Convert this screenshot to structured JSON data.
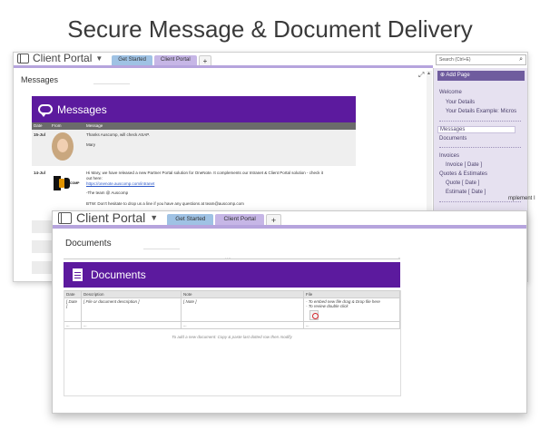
{
  "headline": "Secure Message & Document Delivery",
  "colors": {
    "accent_purple": "#5c1a9e",
    "tab_blue": "#9fc2e4",
    "tab_lilac": "#c6b6e6",
    "sidebar_bg": "#e6e1f0"
  },
  "back_window": {
    "notebook_title": "Client Portal",
    "tabs": [
      "Get Started",
      "Client Portal",
      "+"
    ],
    "search_placeholder": "Search (Ctrl+E)",
    "page_title": "Messages",
    "banner_title": "Messages",
    "grid_headers": [
      "Date",
      "From",
      "Message"
    ],
    "messages": [
      {
        "date": "15-Jul",
        "lines": [
          "Thanks Auscomp, will check ASAP.",
          "Mary"
        ]
      },
      {
        "date": "14-Jul",
        "lines": [
          "Hi Mary, we have released a new Partner Portal solution for OneNote. It complements our Intranet & Client Portal solution - check it",
          "out here:",
          "https://onenote.auscomp.com/intranet",
          "-The team @ Auscomp",
          "BTW: Don't hesitate to drop us a line if you have any questions at team@auscomp.com"
        ]
      }
    ],
    "logo_text": "COMP",
    "sidebar": {
      "add_page": "Add Page",
      "items": [
        "Welcome",
        "Your Details",
        "Your Details Example: Micros",
        "Messages",
        "Documents",
        "Invoices",
        "Invoice [ Date ]",
        "Quotes & Estimates",
        "Quote [ Date ]",
        "Estimate [ Date ]"
      ]
    },
    "right_fragment": "mplement I"
  },
  "front_window": {
    "notebook_title": "Client Portal",
    "tabs": [
      "Get Started",
      "Client Portal",
      "+"
    ],
    "page_title": "Documents",
    "banner_title": "Documents",
    "table_headers": [
      "Date",
      "Description",
      "Note",
      "File"
    ],
    "rows": [
      {
        "date": "[ Date ]",
        "description": "[ File or document description ]",
        "note": "[ Note ]",
        "file_lines": [
          "- To embed new file drag & Drop file here",
          "- To review double click"
        ]
      },
      {
        "date": "...",
        "description": "...",
        "note": "...",
        "file_lines": [
          "..."
        ]
      }
    ],
    "hint": "To add a new document: Copy & paste last dotted row then modify"
  }
}
